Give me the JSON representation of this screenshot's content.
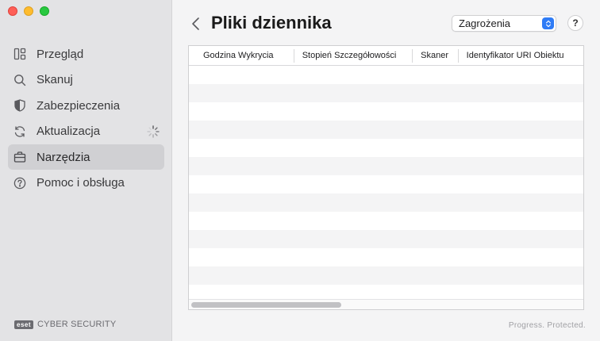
{
  "window": {
    "traffic_lights": [
      "close",
      "minimize",
      "zoom"
    ]
  },
  "sidebar": {
    "items": [
      {
        "label": "Przegląd",
        "icon": "overview-icon",
        "active": false
      },
      {
        "label": "Skanuj",
        "icon": "search-icon",
        "active": false
      },
      {
        "label": "Zabezpieczenia",
        "icon": "shield-icon",
        "active": false
      },
      {
        "label": "Aktualizacja",
        "icon": "refresh-icon",
        "active": false,
        "loading": true
      },
      {
        "label": "Narzędzia",
        "icon": "briefcase-icon",
        "active": true
      },
      {
        "label": "Pomoc i obsługa",
        "icon": "help-icon",
        "active": false
      }
    ],
    "brand_badge": "eset",
    "brand_text": "CYBER SECURITY"
  },
  "main": {
    "title": "Pliki dziennika",
    "log_type_select": {
      "value": "Zagrożenia"
    },
    "help_label": "?",
    "table": {
      "columns": [
        "Godzina Wykrycia",
        "Stopień Szczegółowości",
        "Skaner",
        "Identyfikator URI Obiektu"
      ],
      "rows": []
    },
    "tagline": "Progress. Protected."
  },
  "colors": {
    "sidebar_bg": "#e3e3e5",
    "active_item_bg": "#d0d0d3",
    "accent": "#2f7cf6"
  }
}
